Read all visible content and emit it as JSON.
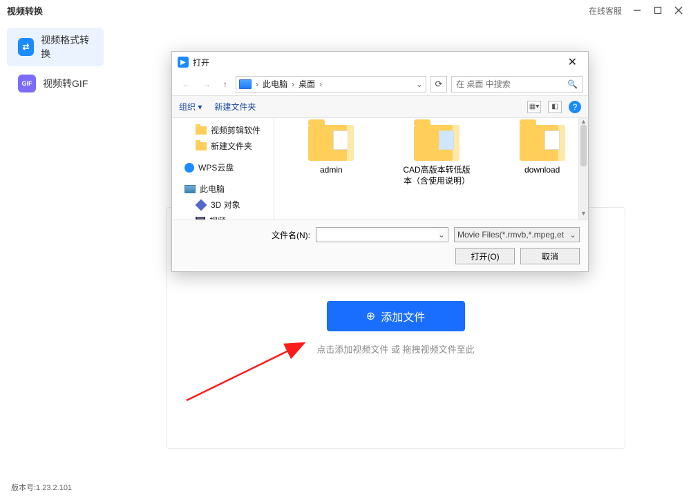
{
  "app": {
    "title": "视频转换",
    "support": "在线客服"
  },
  "sidebar": {
    "items": [
      {
        "label": "视频格式转换",
        "active": true,
        "icon": "swap"
      },
      {
        "label": "视频转GIF",
        "active": false,
        "icon": "GIF"
      }
    ]
  },
  "main": {
    "add_button": "添加文件",
    "hint": "点击添加视频文件 或 拖拽视频文件至此"
  },
  "footer": {
    "version": "版本号:1.23.2.101"
  },
  "dialog": {
    "title": "打开",
    "breadcrumb": [
      "此电脑",
      "桌面"
    ],
    "search_placeholder": "在 桌面 中搜索",
    "toolbar": {
      "organize": "组织",
      "new_folder": "新建文件夹"
    },
    "tree": [
      {
        "label": "视频剪辑软件",
        "icon": "folder",
        "indent": 1
      },
      {
        "label": "新建文件夹",
        "icon": "folder",
        "indent": 1
      },
      {
        "label": "WPS云盘",
        "icon": "wps",
        "indent": 0
      },
      {
        "label": "此电脑",
        "icon": "pc",
        "indent": 0
      },
      {
        "label": "3D 对象",
        "icon": "cube",
        "indent": 1
      },
      {
        "label": "视频",
        "icon": "film",
        "indent": 1
      }
    ],
    "files": [
      {
        "name": "admin",
        "doc": "plain"
      },
      {
        "name": "CAD高版本转低版本（含使用说明）",
        "doc": "blue"
      },
      {
        "name": "download",
        "doc": "plain"
      }
    ],
    "filename_label": "文件名(N):",
    "filename_value": "",
    "filter": "Movie Files(*.rmvb,*.mpeg,et",
    "open_btn": "打开(O)",
    "cancel_btn": "取消"
  }
}
